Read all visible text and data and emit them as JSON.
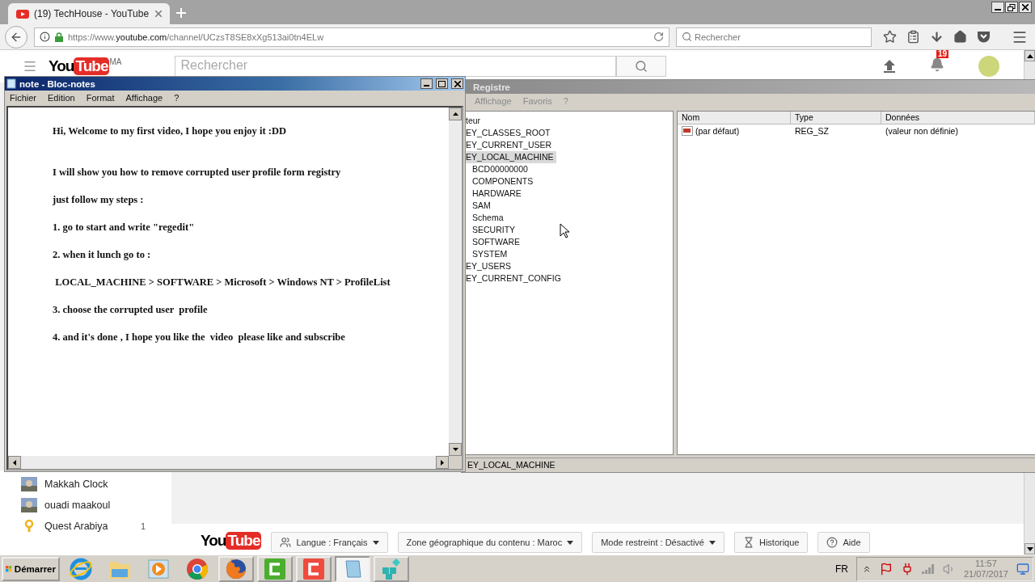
{
  "browser": {
    "tab": {
      "title": "(19) TechHouse - YouTube"
    },
    "url": {
      "prefix": "https://www.",
      "domain": "youtube.com",
      "path": "/channel/UCzsT8SE8xXg513ai0tn4ELw"
    },
    "search": {
      "placeholder": "Rechercher"
    }
  },
  "youtube": {
    "logo": {
      "left": "You",
      "right": "Tube",
      "region": "MA"
    },
    "search": {
      "placeholder": "Rechercher"
    },
    "notification_count": "19",
    "subscriptions": [
      {
        "name": "Makkah Clock"
      },
      {
        "name": "ouadi maakoul"
      },
      {
        "name": "Quest Arabiya",
        "kind": "pin",
        "count": "1"
      }
    ],
    "footer": {
      "logo": {
        "left": "You",
        "right": "Tube"
      },
      "buttons": [
        {
          "label": "Langue : Français",
          "kind": "language"
        },
        {
          "label": "Zone géographique du contenu : Maroc",
          "kind": "dropdown"
        },
        {
          "label": "Mode restreint : Désactivé",
          "kind": "dropdown"
        },
        {
          "label": "Historique",
          "kind": "history"
        },
        {
          "label": "Aide",
          "kind": "help"
        }
      ]
    }
  },
  "registry": {
    "title": "Registre",
    "menu": [
      "Affichage",
      "Favoris",
      "?"
    ],
    "tree": [
      {
        "label": "teur",
        "selected": false,
        "children": [
          {
            "label": "EY_CLASSES_ROOT",
            "selected": false
          },
          {
            "label": "EY_CURRENT_USER",
            "selected": false
          },
          {
            "label": "EY_LOCAL_MACHINE",
            "selected": true,
            "children": [
              {
                "label": "BCD00000000",
                "selected": false
              },
              {
                "label": "COMPONENTS",
                "selected": false
              },
              {
                "label": "HARDWARE",
                "selected": false
              },
              {
                "label": "SAM",
                "selected": false
              },
              {
                "label": "Schema",
                "selected": false
              },
              {
                "label": "SECURITY",
                "selected": false
              },
              {
                "label": "SOFTWARE",
                "selected": false
              },
              {
                "label": "SYSTEM",
                "selected": false
              }
            ]
          },
          {
            "label": "EY_USERS",
            "selected": false
          },
          {
            "label": "EY_CURRENT_CONFIG",
            "selected": false
          }
        ]
      }
    ],
    "columns": [
      "Nom",
      "Type",
      "Données"
    ],
    "rows": [
      {
        "name": "(par défaut)",
        "type": "REG_SZ",
        "data": "(valeur non définie)"
      }
    ],
    "status": "EY_LOCAL_MACHINE"
  },
  "notepad": {
    "title": "note - Bloc-notes",
    "menu": [
      "Fichier",
      "Edition",
      "Format",
      "Affichage",
      "?"
    ],
    "lines": [
      "Hi, Welcome to my first video, I hope you enjoy it :DD",
      "I will show you how to remove corrupted user profile form registry",
      "just follow my steps :",
      "1. go to start and write \"regedit\"",
      "2. when it lunch go to :",
      " LOCAL_MACHINE > SOFTWARE > Microsoft > Windows NT > ProfileList",
      "3. choose the corrupted user  profile",
      "4. and it's done , I hope you like the  video  please like and subscribe"
    ]
  },
  "taskbar": {
    "start": "Démarrer",
    "apps": [
      {
        "kind": "ie",
        "selected": false,
        "running": false
      },
      {
        "kind": "explorer",
        "selected": false,
        "running": false
      },
      {
        "kind": "media",
        "selected": false,
        "running": false
      },
      {
        "kind": "chrome",
        "selected": false,
        "running": false
      },
      {
        "kind": "firefox",
        "selected": false,
        "running": true
      },
      {
        "kind": "camtasia-green",
        "selected": false,
        "running": true
      },
      {
        "kind": "camtasia-red",
        "selected": false,
        "running": true
      },
      {
        "kind": "notepad",
        "selected": true,
        "running": true
      },
      {
        "kind": "regedit",
        "selected": false,
        "running": true
      }
    ],
    "language": "FR",
    "time": "11:57",
    "date": "21/07/2017"
  }
}
